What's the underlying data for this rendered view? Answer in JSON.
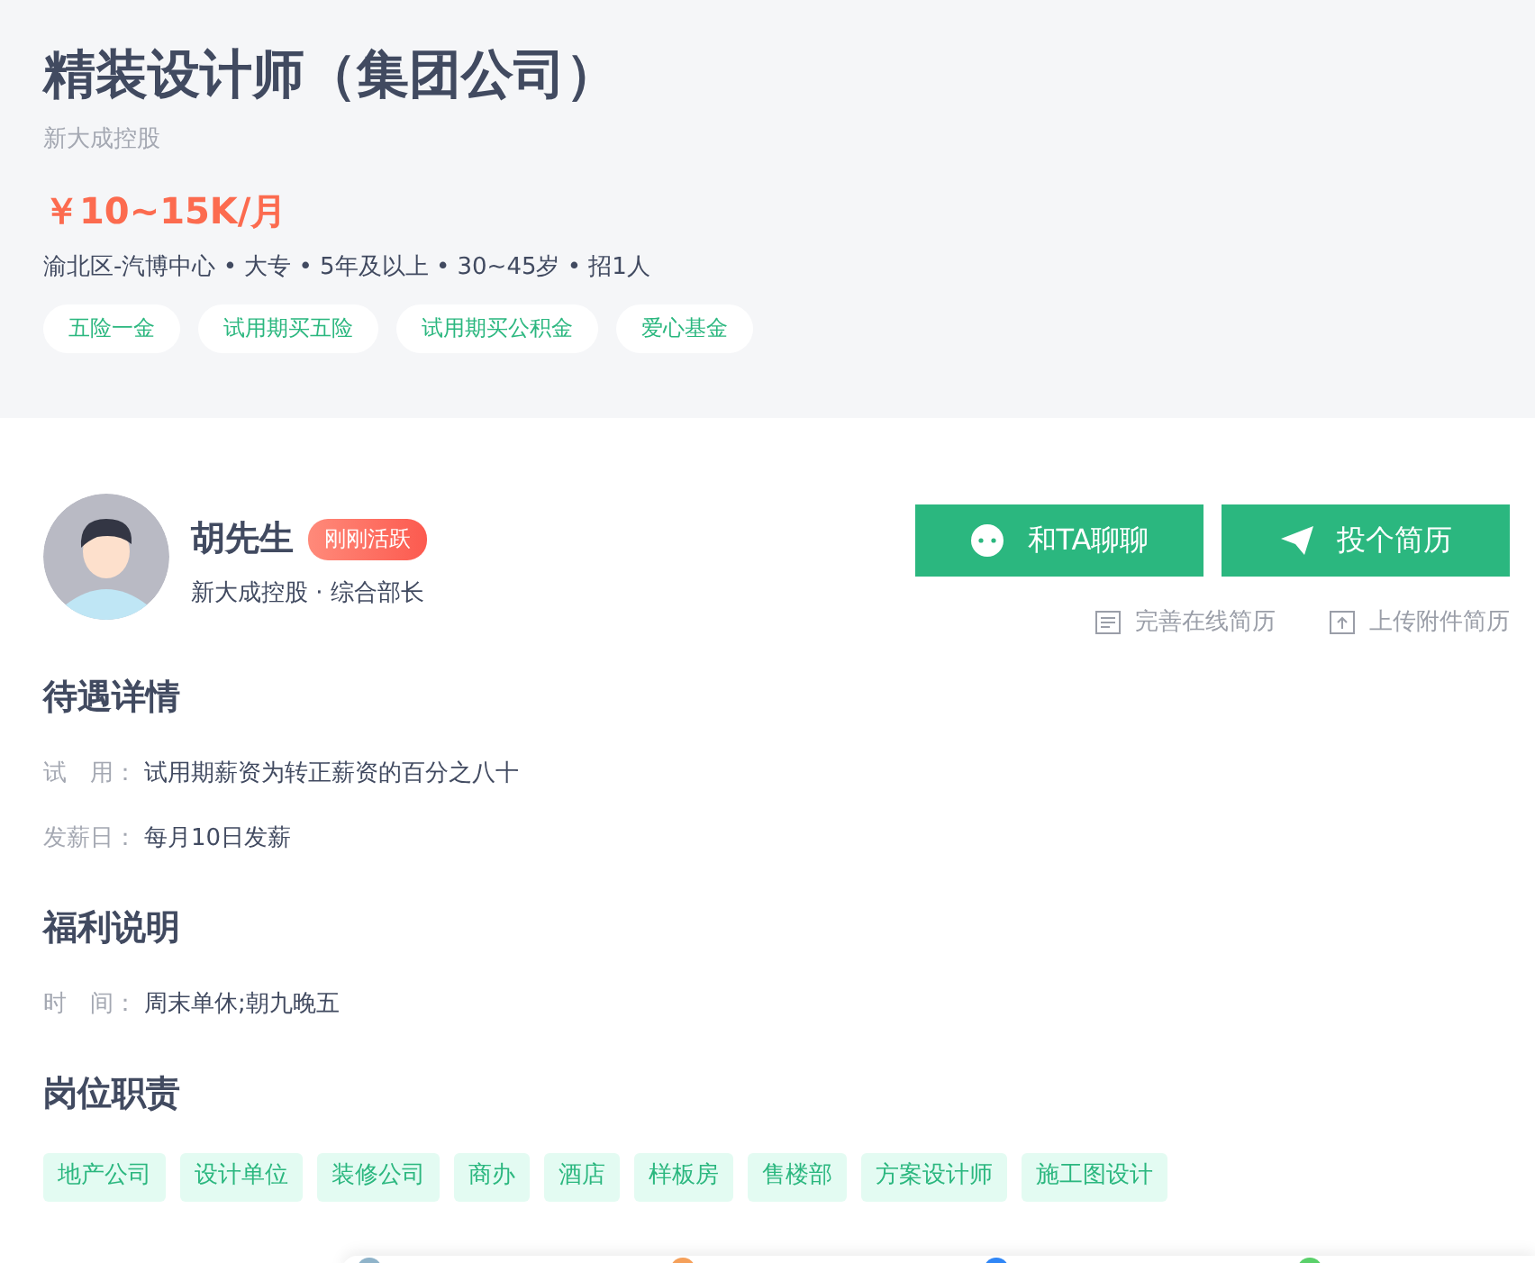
{
  "job": {
    "title": "精装设计师（集团公司）",
    "company": "新大成控股",
    "salary": "￥10~15K/月",
    "requirements": "渝北区-汽博中心 • 大专 • 5年及以上  • 30~45岁 • 招1人",
    "benefit_tags": [
      "五险一金",
      "试用期买五险",
      "试用期买公积金",
      "爱心基金"
    ]
  },
  "recruiter": {
    "name": "胡先生",
    "badge": "刚刚活跃",
    "title": "新大成控股 · 综合部长"
  },
  "actions": [
    {
      "label": "和TA聊聊",
      "kind": "chat"
    },
    {
      "label": "投个简历",
      "kind": "send"
    }
  ],
  "links": [
    {
      "label": "完善在线简历",
      "kind": "doc"
    },
    {
      "label": "上传附件简历",
      "kind": "upload"
    }
  ],
  "sections": [
    {
      "heading": "待遇详情",
      "rows": [
        {
          "label": "试　用：",
          "value": "试用期薪资为转正薪资的百分之八十"
        },
        {
          "label": "发薪日：",
          "value": "每月10日发薪"
        }
      ]
    },
    {
      "heading": "福利说明",
      "rows": [
        {
          "label": "时　间：",
          "value": "周末单休;朝九晚五"
        }
      ]
    },
    {
      "heading": "岗位职责",
      "tags": [
        "地产公司",
        "设计单位",
        "装修公司",
        "商办",
        "酒店",
        "样板房",
        "售楼部",
        "方案设计师",
        "施工图设计"
      ]
    }
  ]
}
